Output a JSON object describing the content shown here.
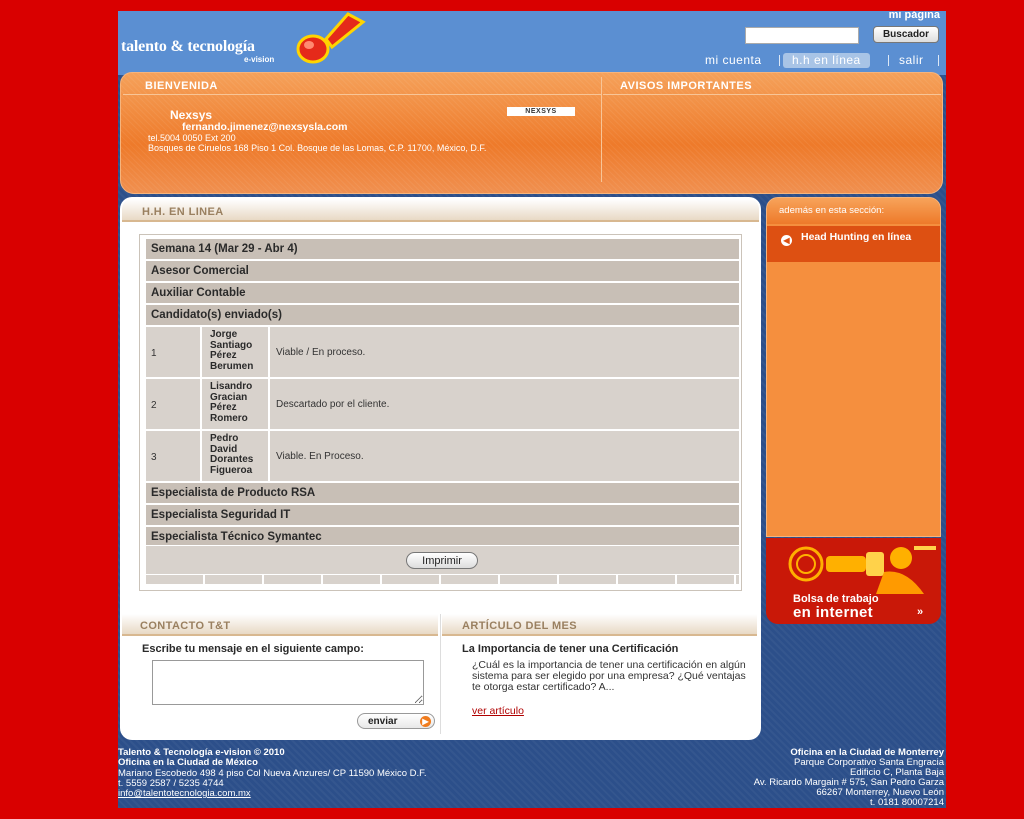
{
  "header": {
    "logo_text": "talento & tecnología",
    "logo_sub": "e-vision",
    "my_page": "mi página",
    "search_placeholder": "",
    "search_button": "Buscador",
    "nav": [
      "mi cuenta",
      "h.h en línea",
      "salir"
    ]
  },
  "welcome": {
    "heading": "BIENVENIDA",
    "notices_heading": "AVISOS IMPORTANTES",
    "company": "Nexsys",
    "email": "fernando.jimenez@nexsysla.com",
    "phone": "tel.5004 0050 Ext 200",
    "address": "Bosques de Ciruelos 168 Piso 1 Col. Bosque de las Lomas, C.P. 11700, México, D.F.",
    "company_logo": "NEXSYS"
  },
  "hh": {
    "heading": "H.H. EN LINEA",
    "week": "Semana 14 (Mar 29 - Abr 4)",
    "positions_top": [
      "Asesor Comercial",
      "Auxiliar Contable"
    ],
    "candidates_label": "Candidato(s) enviado(s)",
    "candidates": [
      {
        "num": "1",
        "name": "Jorge Santiago Pérez Berumen",
        "status": "Viable / En proceso."
      },
      {
        "num": "2",
        "name": "Lisandro Gracian Pérez Romero",
        "status": "Descartado por el cliente."
      },
      {
        "num": "3",
        "name": "Pedro David Dorantes Figueroa",
        "status": "Viable. En Proceso."
      }
    ],
    "positions_bottom": [
      "Especialista de Producto RSA",
      "Especialista Seguridad IT",
      "Especialista Técnico Symantec"
    ],
    "print_button": "Imprimir"
  },
  "contact": {
    "heading": "CONTACTO T&T",
    "label": "Escribe tu mensaje en el siguiente campo:",
    "send_button": "enviar"
  },
  "article": {
    "heading": "ARTÍCULO DEL MES",
    "title": "La Importancia de tener una Certificación",
    "text": "¿Cuál es la importancia de tener una certificación en algún sistema para ser elegido por una empresa? ¿Qué ventajas te otorga estar certificado? A...",
    "link": "ver artículo"
  },
  "sidebar": {
    "heading": "además en esta sección:",
    "item": "Head Hunting en línea",
    "banner_line1": "Bolsa de trabajo",
    "banner_line2": "en internet",
    "banner_arrow": "»"
  },
  "footer": {
    "left": [
      "Talento & Tecnología e-vision © 2010",
      "Oficina en la Ciudad de México",
      "Mariano Escobedo 498 4 piso Col Nueva Anzures/ CP 11590 México D.F.",
      "t. 5559 2587 / 5235 4744",
      "info@talentotecnologia.com.mx"
    ],
    "right": [
      "Oficina en la Ciudad de Monterrey",
      "Parque Corporativo Santa Engracia",
      "Edificio C, Planta Baja",
      "Av. Ricardo Margain # 575, San Pedro Garza",
      "66267 Monterrey, Nuevo León",
      "t. 0181 80007214"
    ]
  },
  "colors": {
    "background": "#d90000",
    "page": "#2c4f8a",
    "header": "#5b8fd2",
    "orange": "#f08838"
  }
}
